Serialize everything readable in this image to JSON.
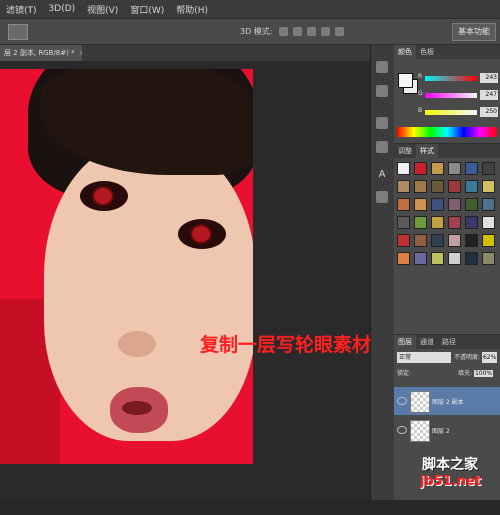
{
  "menu": [
    "滤镜(T)",
    "3D(D)",
    "视图(V)",
    "窗口(W)",
    "帮助(H)"
  ],
  "options_bar": {
    "mode_label": "3D 模式:"
  },
  "workspace_button": "基本功能",
  "document_tab": {
    "title": "层 2 副本, RGB/8#) *",
    "close": "×"
  },
  "tools": {
    "text_tool": "A"
  },
  "color_panel": {
    "tabs": [
      "颜色",
      "色板"
    ],
    "sliders": [
      {
        "label": "R",
        "value": "243",
        "color_from": "#00f5fa",
        "color_to": "#ff0000"
      },
      {
        "label": "G",
        "value": "247",
        "color_from": "#f300fa",
        "color_to": "#f3f7fa"
      },
      {
        "label": "B",
        "value": "250",
        "color_from": "#f3f700",
        "color_to": "#f3f7ff"
      }
    ]
  },
  "styles_panel": {
    "tabs": [
      "调整",
      "样式"
    ],
    "swatches": [
      "#f0f0f0",
      "#c8202a",
      "#c49a4e",
      "#8a8a8a",
      "#3a5a9a",
      "#404040",
      "#b08a60",
      "#a0784a",
      "#6a5a3a",
      "#9a3a3a",
      "#3a7a9a",
      "#d0c060",
      "#c07040",
      "#d09050",
      "#405080",
      "#806070",
      "#406030",
      "#507090",
      "#5a5a5a",
      "#6a9a3a",
      "#c0a040",
      "#a04050",
      "#3a3a6a",
      "#e0e0e0",
      "#c03030",
      "#906040",
      "#304050",
      "#c0a0a0",
      "#202020",
      "#d0c000",
      "#e08040",
      "#6a6aa0",
      "#c0c060",
      "#d0d0d0",
      "#203040",
      "#8a8a6a"
    ]
  },
  "layers_panel": {
    "tabs": [
      "图层",
      "通道",
      "路径"
    ],
    "blend_mode": "正常",
    "opacity_label": "不透明度:",
    "opacity_value": "62%",
    "lock_label": "锁定:",
    "fill_label": "填充:",
    "fill_value": "100%",
    "layers": [
      {
        "name": "图层 2 副本",
        "selected": true
      },
      {
        "name": "图层 2",
        "selected": false
      }
    ]
  },
  "annotation": "复制一层写轮眼素材",
  "watermark": {
    "line1": "脚本之家",
    "line2": "jb51.net"
  }
}
